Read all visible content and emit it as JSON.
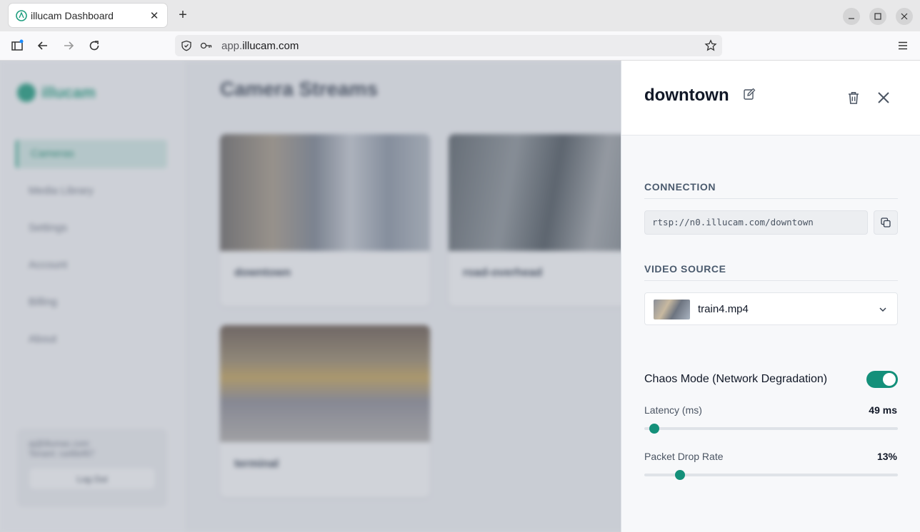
{
  "browser": {
    "tab_title": "illucam Dashboard",
    "url_host": "app.",
    "url_domain": "illucam.com"
  },
  "sidebar": {
    "logo_text": "illucam",
    "items": [
      {
        "label": "Cameras",
        "active": true
      },
      {
        "label": "Media Library"
      },
      {
        "label": "Settings"
      },
      {
        "label": "Account"
      },
      {
        "label": "Billing"
      },
      {
        "label": "About"
      }
    ],
    "account": {
      "email": "aj@illumac.com",
      "tenant": "Tenant: ca48ef67",
      "logout_label": "Log Out"
    }
  },
  "main": {
    "title": "Camera Streams",
    "cameras": [
      {
        "name": "downtown"
      },
      {
        "name": "road-overhead"
      },
      {
        "name": "terminal"
      }
    ]
  },
  "drawer": {
    "title": "downtown",
    "connection_label": "CONNECTION",
    "rtsp_url": "rtsp://n0.illucam.com/downtown",
    "video_source_label": "VIDEO SOURCE",
    "video_file": "train4.mp4",
    "chaos_label": "Chaos Mode (Network Degradation)",
    "chaos_enabled": true,
    "latency_label": "Latency (ms)",
    "latency_value": "49 ms",
    "latency_fraction": 0.04,
    "drop_label": "Packet Drop Rate",
    "drop_value": "13%",
    "drop_fraction": 0.14
  },
  "colors": {
    "accent": "#14907a",
    "brand": "#1e9e7e"
  }
}
